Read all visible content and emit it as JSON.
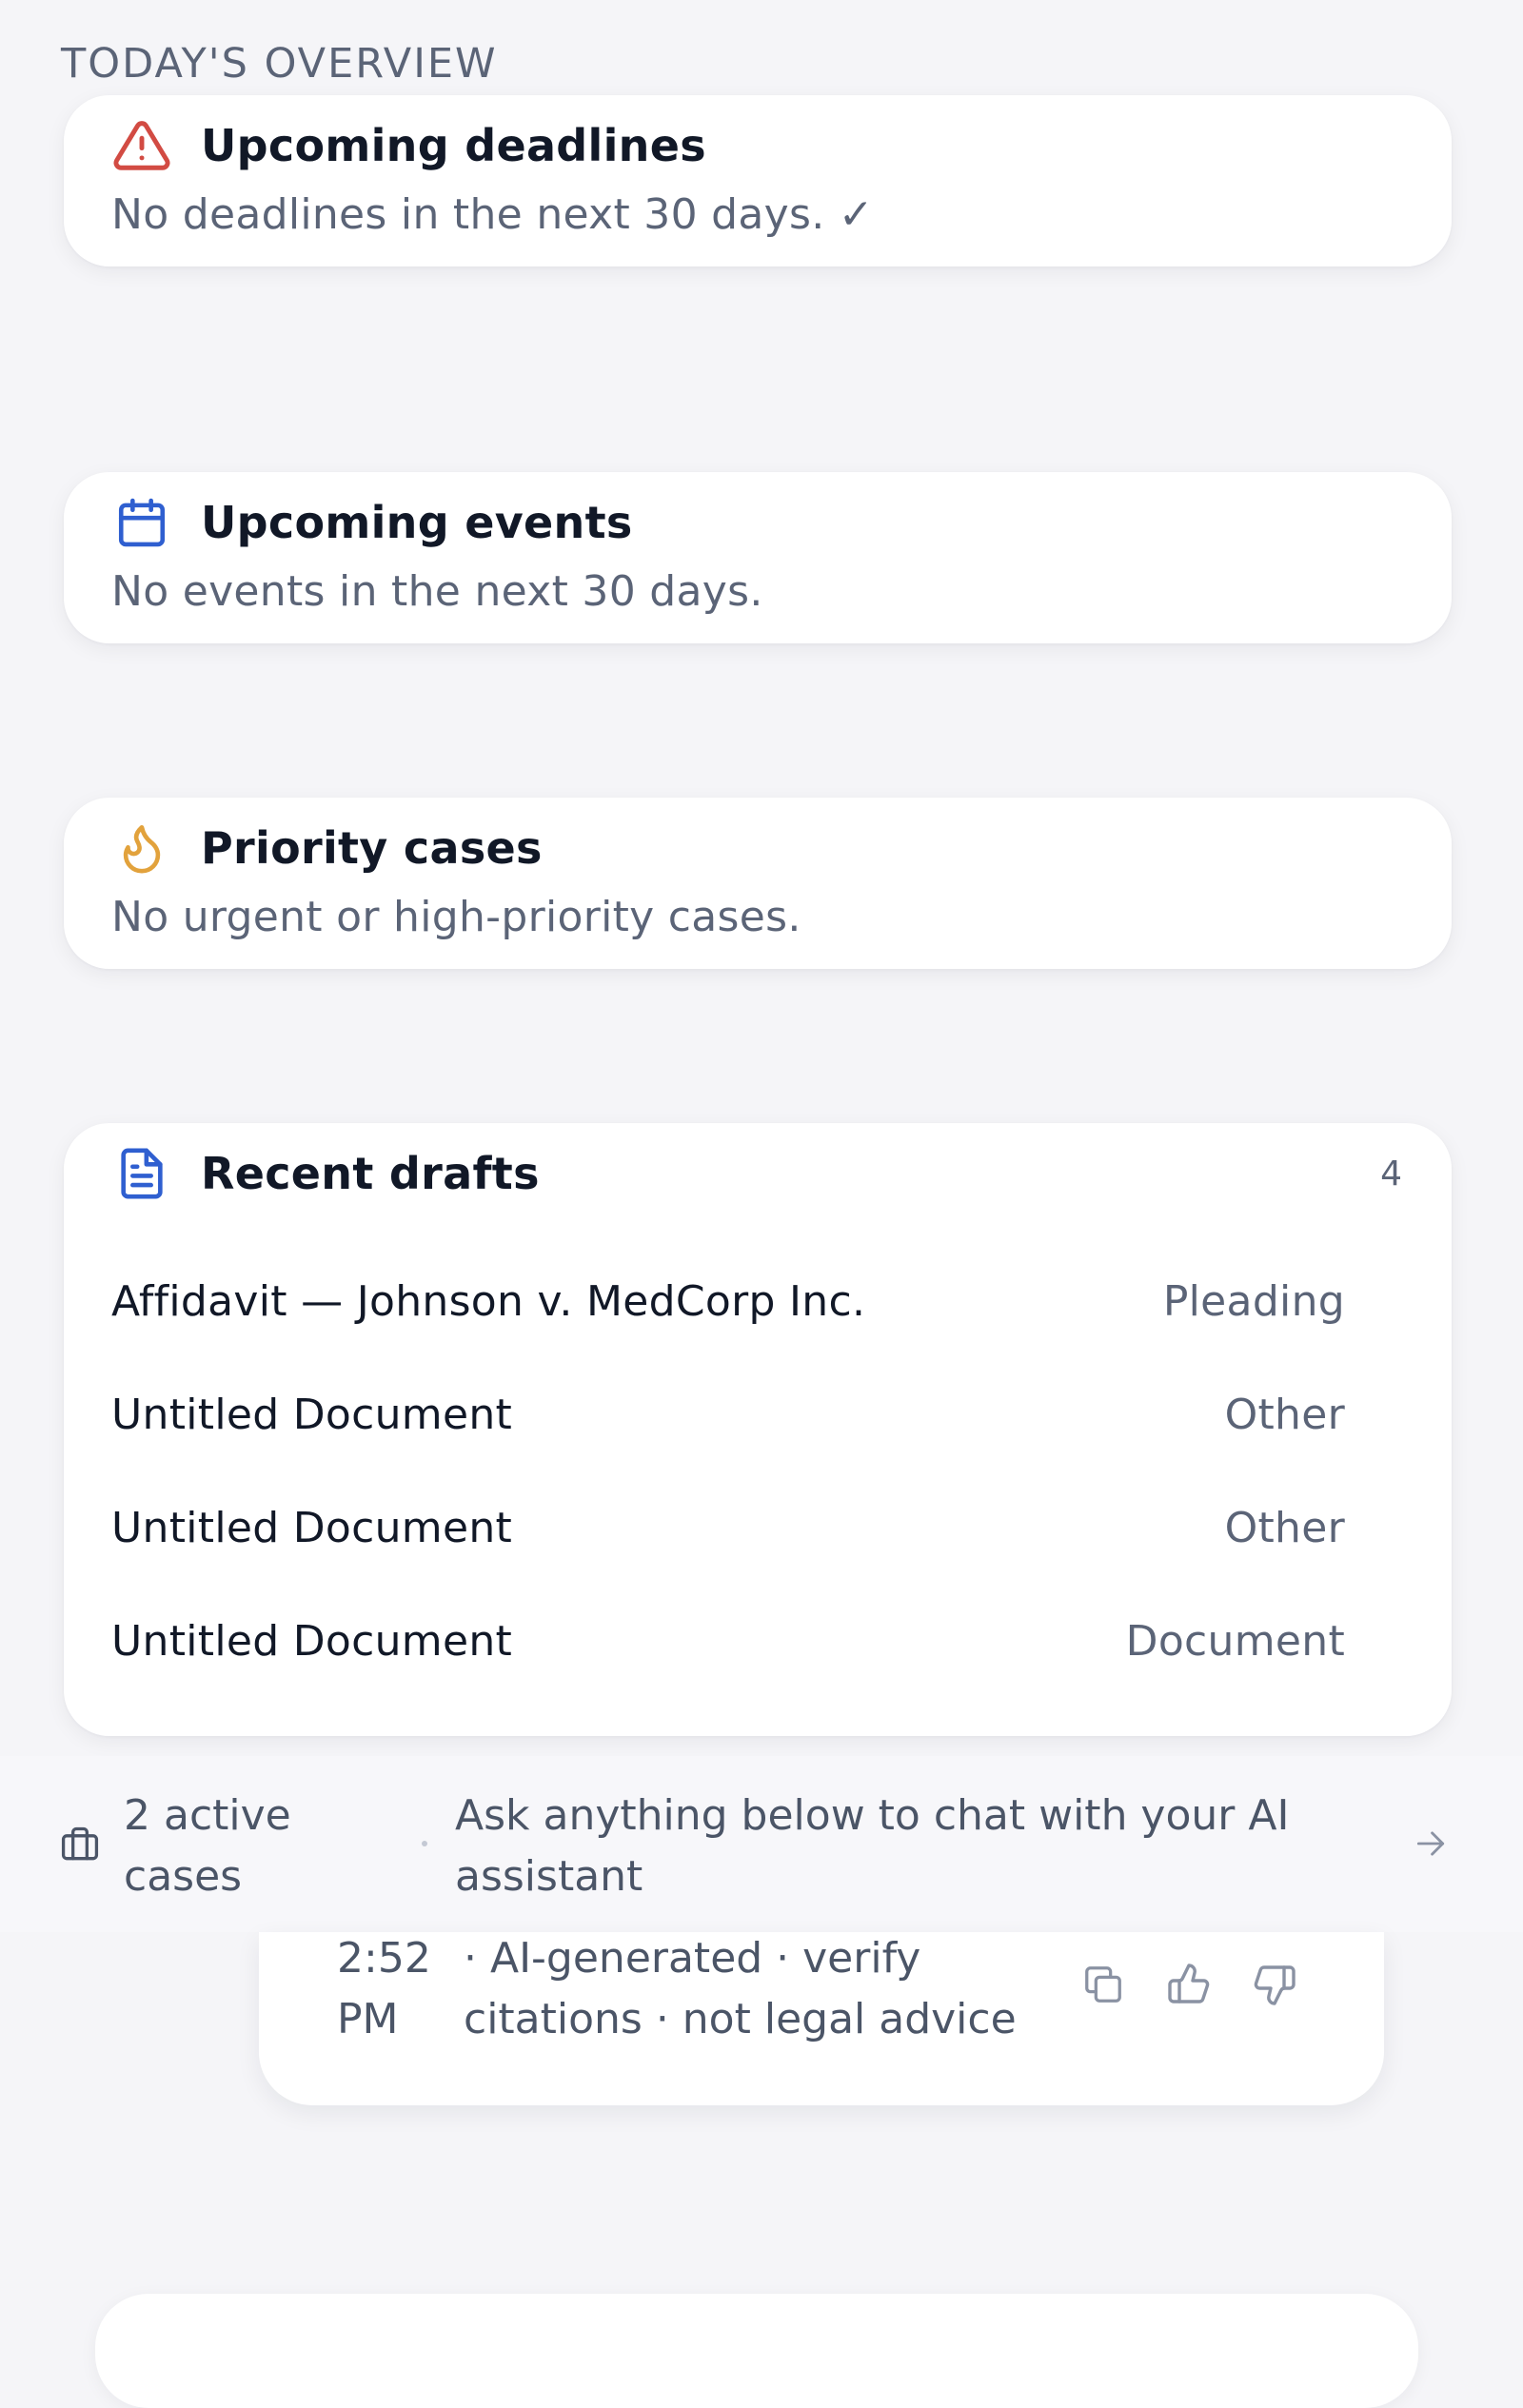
{
  "overview": {
    "section_title": "TODAY'S OVERVIEW"
  },
  "deadlines": {
    "icon": "warning-triangle-icon",
    "title": "Upcoming deadlines",
    "empty_text": "No deadlines in the next 30 days. ✓",
    "accent": "#d24b43"
  },
  "events": {
    "icon": "calendar-icon",
    "title": "Upcoming events",
    "empty_text": "No events in the next 30 days.",
    "accent": "#2f5fd0"
  },
  "priority": {
    "icon": "flame-icon",
    "title": "Priority cases",
    "empty_text": "No urgent or high-priority cases.",
    "accent": "#e2a23c"
  },
  "drafts": {
    "icon": "document-icon",
    "title": "Recent drafts",
    "count": "4",
    "accent": "#2f5fd0",
    "items": [
      {
        "name": "Affidavit — Johnson v. MedCorp Inc.",
        "type": "Pleading"
      },
      {
        "name": "Untitled Document",
        "type": "Other"
      },
      {
        "name": "Untitled Document",
        "type": "Other"
      },
      {
        "name": "Untitled Document",
        "type": "Document"
      }
    ]
  },
  "footer": {
    "cases_icon": "briefcase-icon",
    "active_cases": "2 active cases",
    "separator": "·",
    "ask_prompt": "Ask anything below to chat with your AI assistant",
    "arrow_icon": "arrow-right-icon"
  },
  "message": {
    "time": "2:52 PM",
    "note": "· AI-generated · verify citations · not legal advice",
    "actions": [
      {
        "icon": "copy-icon"
      },
      {
        "icon": "thumbs-up-icon"
      },
      {
        "icon": "thumbs-down-icon"
      }
    ]
  }
}
